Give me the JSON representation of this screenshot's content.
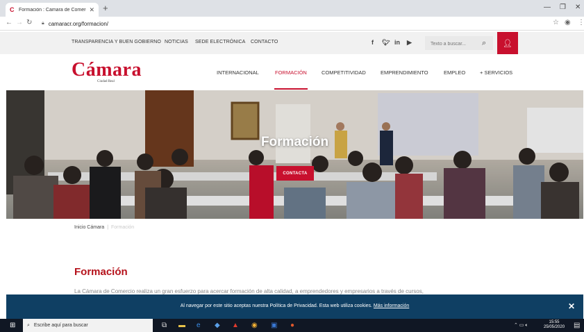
{
  "browser": {
    "tab_title": "Formación : Camara de Comerci",
    "url": "camaracr.org/formacion/"
  },
  "topbar": {
    "links": [
      "TRANSPARENCIA Y BUEN GOBIERNO",
      "NOTICIAS",
      "SEDE ELECTRÓNICA",
      "CONTACTO"
    ],
    "search_placeholder": "Texto a buscar..."
  },
  "logo": {
    "text": "Cámara",
    "subtitle": "Ciudad Real"
  },
  "nav": {
    "items": [
      "INTERNACIONAL",
      "FORMACIÓN",
      "COMPETITIVIDAD",
      "EMPRENDIMIENTO",
      "EMPLEO",
      "+ SERVICIOS"
    ],
    "active": "FORMACIÓN"
  },
  "hero": {
    "title": "Formación",
    "button": "CONTACTA"
  },
  "breadcrumb": {
    "home": "Inicio Cámara",
    "current": "Formación"
  },
  "content": {
    "heading": "Formación",
    "intro": "La Cámara de Comercio realiza un gran esfuerzo para acercar formación de alta calidad, a emprendedores y empresarios a través de cursos,"
  },
  "cookie": {
    "text": "Al navegar por este sitio aceptas nuestra Política de Privacidad. Esta web utiliza cookies.",
    "link": "Más información",
    "close": "✕"
  },
  "taskbar": {
    "search_placeholder": "Escribe aquí para buscar",
    "time": "15:55",
    "date": "25/05/2020"
  },
  "colors": {
    "brand": "#c8102e",
    "cookie_bg": "#0f3f63",
    "taskbar_bg": "#101724"
  }
}
